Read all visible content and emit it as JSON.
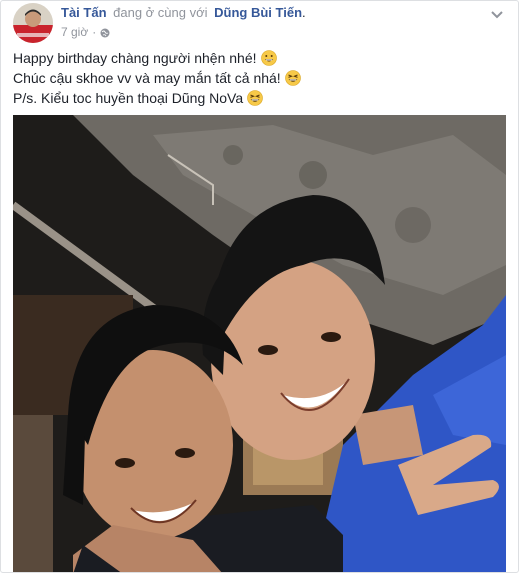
{
  "post": {
    "author_name": "Tài Tấn",
    "with_text": "đang ở cùng với",
    "tagged_name": "Dũng Bùi Tiến",
    "period": ".",
    "time": "7 giờ",
    "dot": "·",
    "privacy_icon": "globe-icon",
    "menu_icon": "chevron-down-icon",
    "lines": [
      "Happy birthday chàng người nhện nhé!",
      "Chúc cậu skhoe vv và may mắn tất cả nhá!",
      "P/s. Kiểu toc huyền thoại Dũng NoVa"
    ],
    "emoji_icons": [
      "grin-emoji-icon",
      "laughing-emoji-icon",
      "laughing-emoji-icon"
    ],
    "photo_alt": "Selfie"
  },
  "colors": {
    "link": "#365899",
    "meta": "#90949c",
    "text": "#1d2129",
    "border": "#dddfe2",
    "shirt_blue": "#2f56c6"
  }
}
